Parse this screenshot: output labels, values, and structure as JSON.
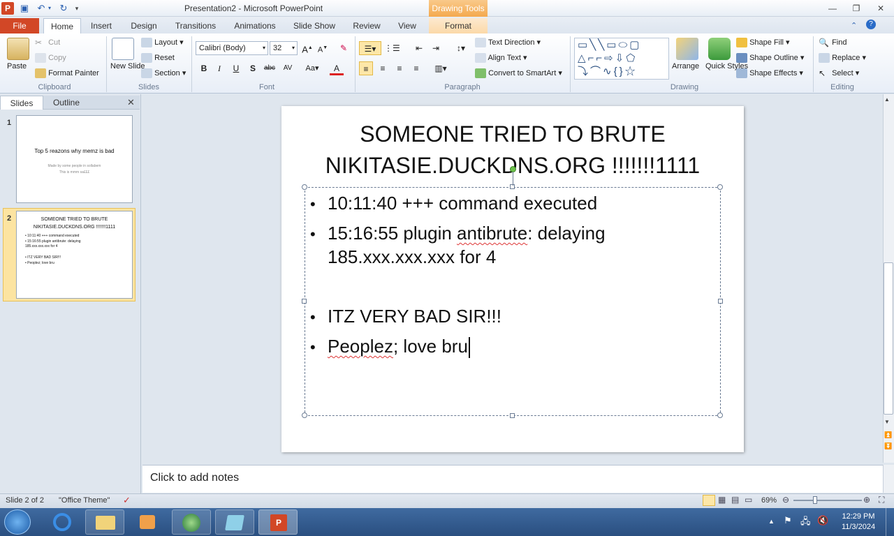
{
  "window": {
    "title": "Presentation2  -  Microsoft PowerPoint",
    "contextual_tab": "Drawing Tools"
  },
  "tabs": {
    "file": "File",
    "home": "Home",
    "insert": "Insert",
    "design": "Design",
    "transitions": "Transitions",
    "animations": "Animations",
    "slideshow": "Slide Show",
    "review": "Review",
    "view": "View",
    "format": "Format"
  },
  "ribbon": {
    "clipboard": {
      "paste": "Paste",
      "cut": "Cut",
      "copy": "Copy",
      "format_painter": "Format Painter",
      "label": "Clipboard"
    },
    "slides": {
      "new_slide": "New Slide",
      "layout": "Layout",
      "reset": "Reset",
      "section": "Section",
      "label": "Slides"
    },
    "font": {
      "family": "Calibri (Body)",
      "size": "32",
      "label": "Font"
    },
    "paragraph": {
      "text_direction": "Text Direction",
      "align_text": "Align Text",
      "convert_smartart": "Convert to SmartArt",
      "label": "Paragraph"
    },
    "drawing": {
      "arrange": "Arrange",
      "quick_styles": "Quick Styles",
      "shape_fill": "Shape Fill",
      "shape_outline": "Shape Outline",
      "shape_effects": "Shape Effects",
      "label": "Drawing"
    },
    "editing": {
      "find": "Find",
      "replace": "Replace",
      "select": "Select",
      "label": "Editing"
    }
  },
  "pane": {
    "tab_slides": "Slides",
    "tab_outline": "Outline",
    "thumbs": [
      {
        "num": "1",
        "title": "Top 5 reazons why memz is bad",
        "sub1": "Made by some people in sollabem",
        "sub2": "This is mmm sa£££"
      },
      {
        "num": "2",
        "title": "SOMEONE TRIED TO BRUTE NIKITASIE.DUCKDNS.ORG !!!!!!!1111",
        "b1": "10:11:40 +++ command executed",
        "b2": "15:16:55 plugin antibrute: delaying 185.xxx.xxx.xxx for 4",
        "b3": "ITZ VERY BAD SIR!!!",
        "b4": "Peoplez; love bru"
      }
    ]
  },
  "slide": {
    "title_line1": "SOMEONE TRIED TO BRUTE",
    "title_line2": "NIKITASIE.DUCKDNS.ORG !!!!!!!1111",
    "bullets": {
      "b1": "10:11:40 +++ command executed",
      "b2_part1": "15:16:55 plugin ",
      "b2_squiggle": "antibrute",
      "b2_part2": ": delaying",
      "b2_line2": "185.xxx.xxx.xxx for 4",
      "b3": "ITZ VERY BAD SIR!!!",
      "b4_squiggle": "Peoplez",
      "b4_rest": "; love bru"
    },
    "bullet_char": "•"
  },
  "notes": {
    "placeholder": "Click to add notes"
  },
  "status": {
    "slide": "Slide 2 of 2",
    "theme": "\"Office Theme\"",
    "zoom": "69%"
  },
  "taskbar": {
    "time": "12:29 PM",
    "date": "11/3/2024"
  },
  "colors": {
    "file_tab": "#d24726",
    "drawing_tools": "#f4a94e",
    "accent": "#2a5fb0"
  }
}
